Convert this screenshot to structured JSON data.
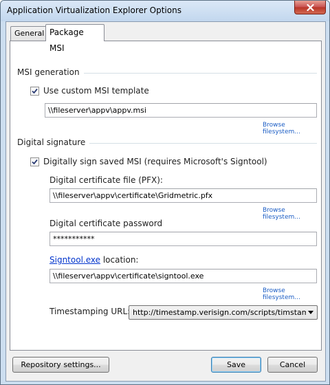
{
  "window": {
    "title": "Application Virtualization Explorer Options"
  },
  "tabs": [
    {
      "label": "General",
      "active": false
    },
    {
      "label": "Package MSI",
      "active": true
    }
  ],
  "msi_generation": {
    "section_label": "MSI generation",
    "use_custom_template_label": "Use custom MSI template",
    "use_custom_template_checked": true,
    "template_path": "\\\\fileserver\\appv\\appv.msi",
    "browse_label": "Browse filesystem..."
  },
  "digital_signature": {
    "section_label": "Digital signature",
    "sign_label": "Digitally sign saved MSI (requires Microsoft's Signtool)",
    "sign_checked": true,
    "cert_file_label": "Digital certificate file (PFX):",
    "cert_file_path": "\\\\fileserver\\appv\\certificate\\Gridmetric.pfx",
    "cert_browse_label": "Browse filesystem...",
    "password_label": "Digital certificate password",
    "password_value": "***********",
    "signtool_link": "Signtool.exe",
    "signtool_label_suffix": " location:",
    "signtool_path": "\\\\fileserver\\appv\\certificate\\signtool.exe",
    "signtool_browse_label": "Browse filesystem...",
    "timestamp_label": "Timestamping URL:",
    "timestamp_url": "http://timestamp.verisign.com/scripts/timstamp.dll"
  },
  "buttons": {
    "repository": "Repository settings...",
    "save": "Save",
    "cancel": "Cancel"
  },
  "icons": {
    "close": "close-icon",
    "check": "checkmark-icon",
    "dropdown": "chevron-down-icon"
  }
}
